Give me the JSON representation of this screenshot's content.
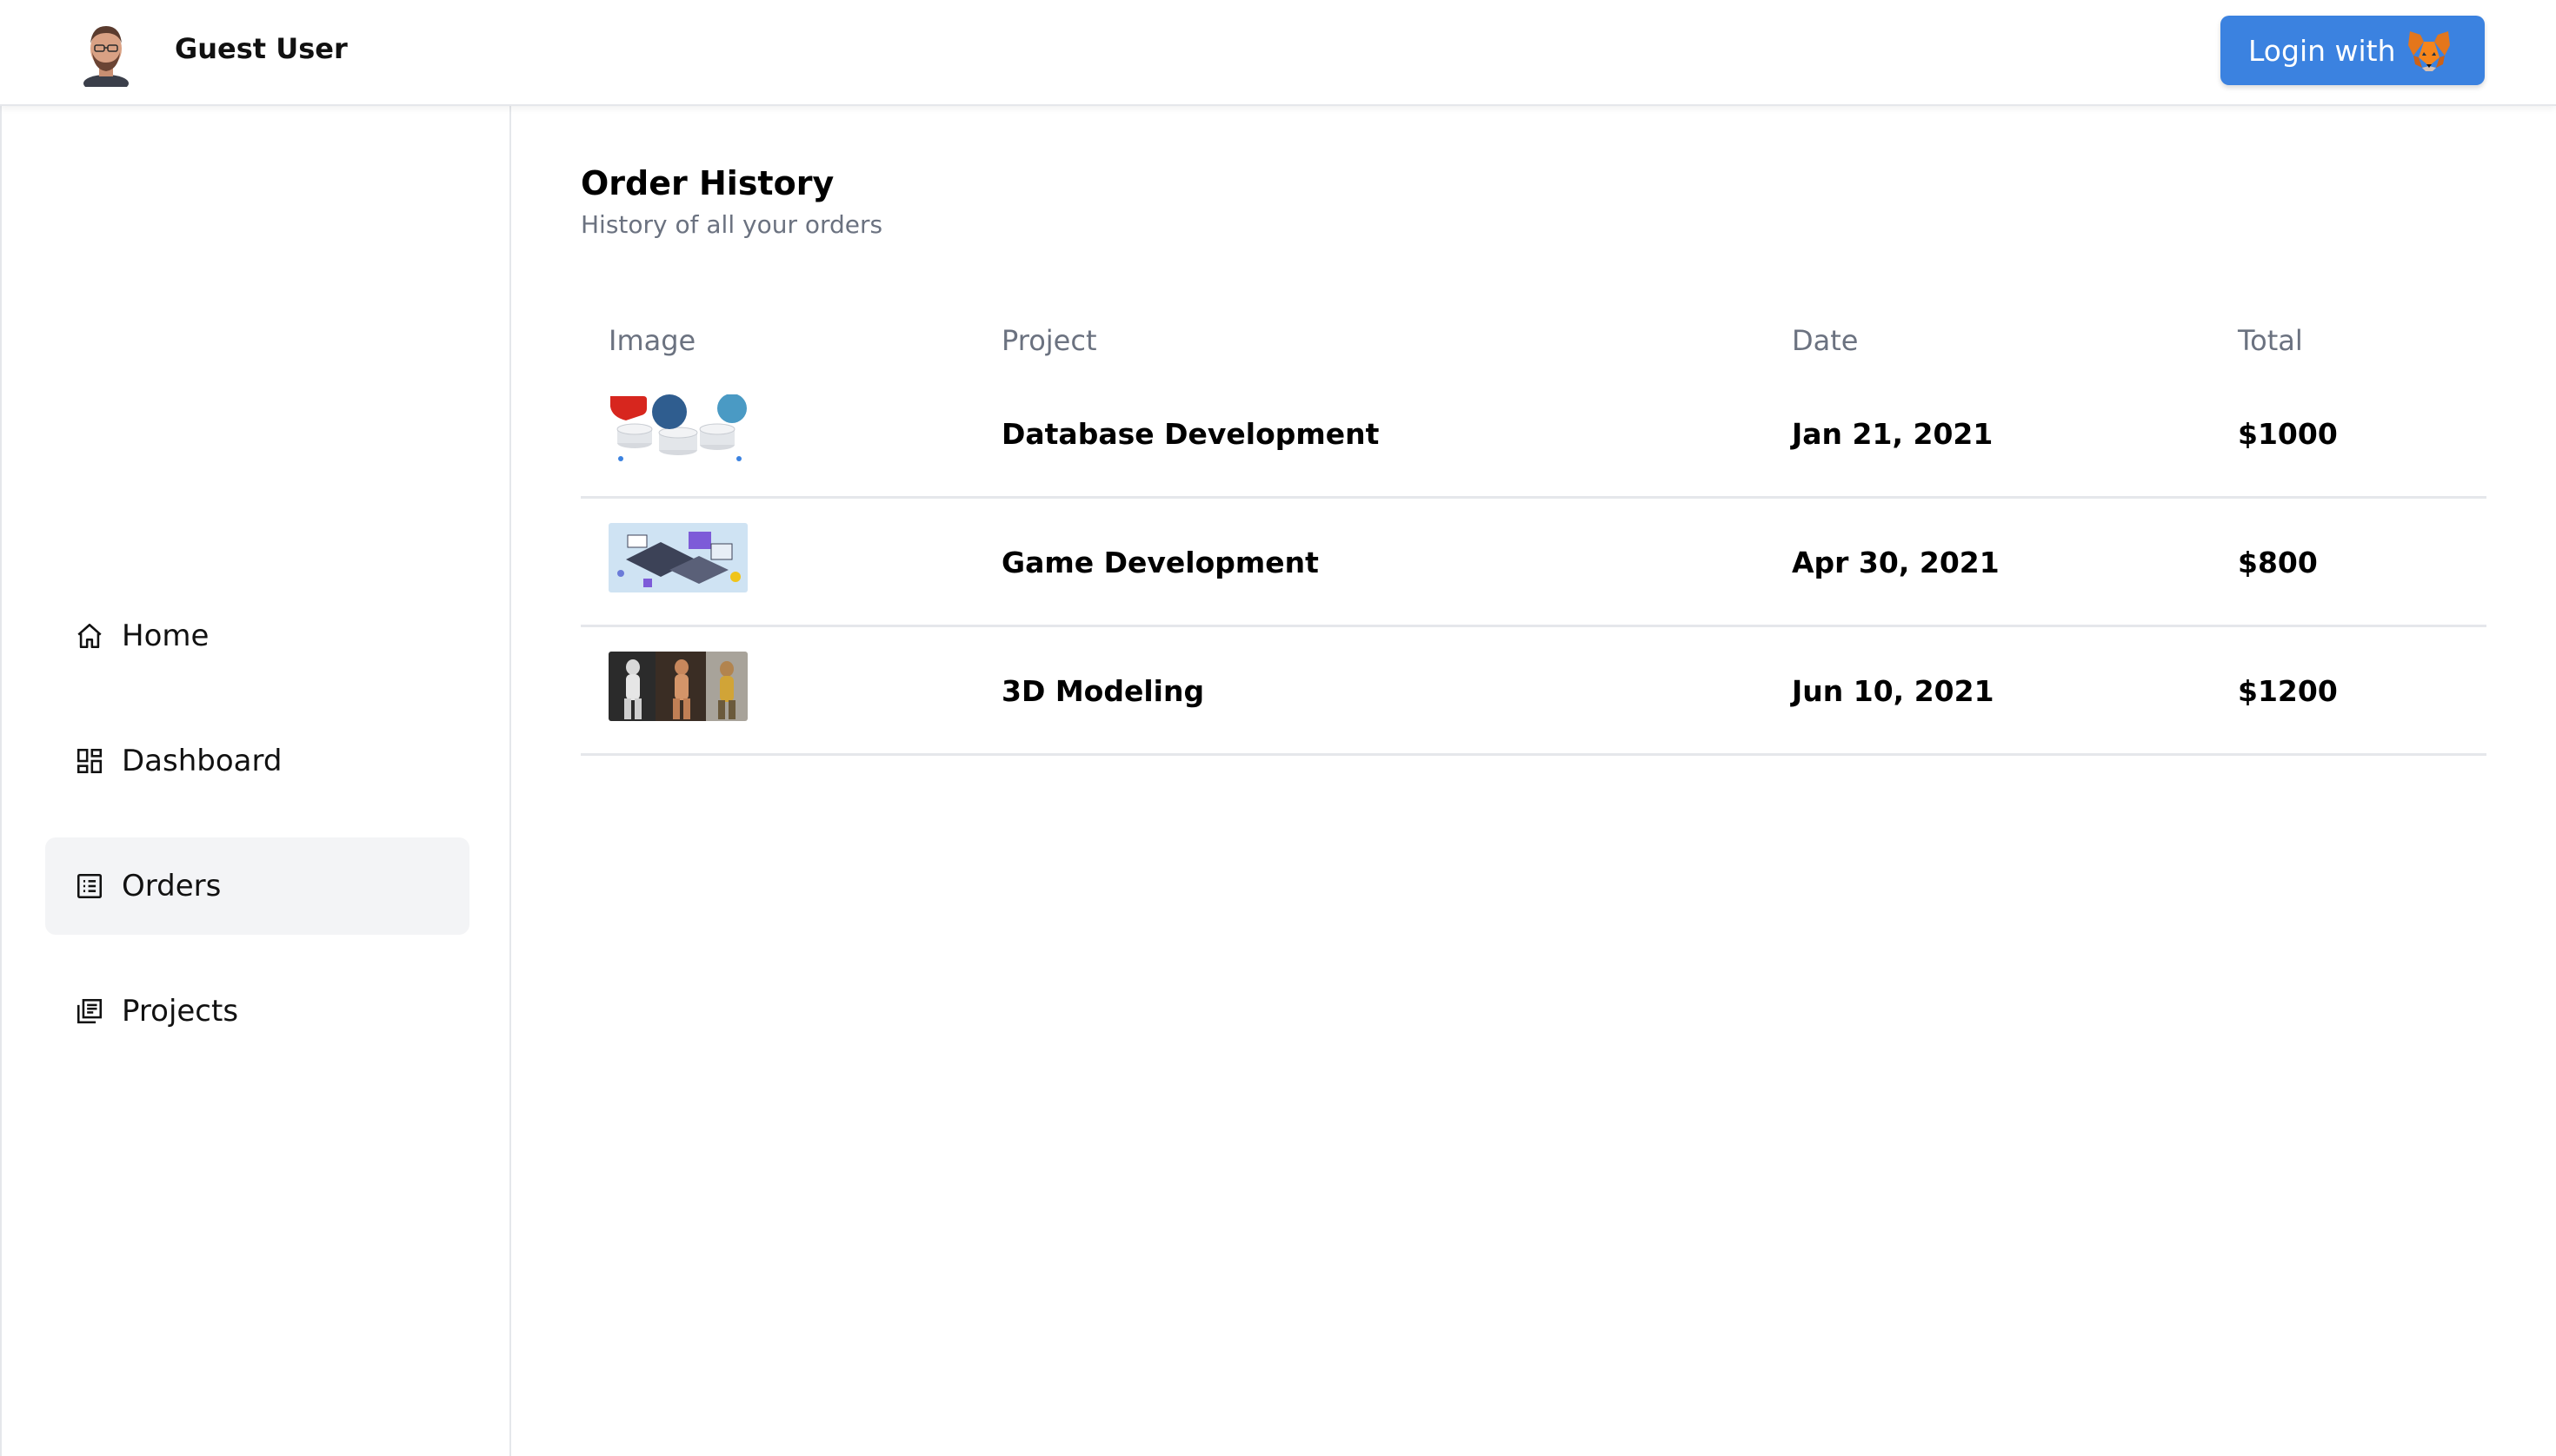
{
  "header": {
    "user_name": "Guest User",
    "login_label": "Login with"
  },
  "sidebar": {
    "items": [
      {
        "label": "Home",
        "icon": "home-icon",
        "active": false
      },
      {
        "label": "Dashboard",
        "icon": "dashboard-icon",
        "active": false
      },
      {
        "label": "Orders",
        "icon": "orders-icon",
        "active": true
      },
      {
        "label": "Projects",
        "icon": "projects-icon",
        "active": false
      }
    ]
  },
  "main": {
    "title": "Order History",
    "subtitle": "History of all your orders",
    "table": {
      "columns": [
        "Image",
        "Project",
        "Date",
        "Total"
      ],
      "rows": [
        {
          "project": "Database Development",
          "date": "Jan 21, 2021",
          "total": "$1000",
          "thumb": "database-thumbnail"
        },
        {
          "project": "Game Development",
          "date": "Apr 30, 2021",
          "total": "$800",
          "thumb": "game-dev-thumbnail"
        },
        {
          "project": "3D Modeling",
          "date": "Jun 10, 2021",
          "total": "$1200",
          "thumb": "3d-modeling-thumbnail"
        }
      ]
    }
  },
  "colors": {
    "accent": "#3b82e0",
    "muted_text": "#6b7280",
    "divider": "#e5e7eb",
    "active_bg": "#f3f4f6"
  }
}
